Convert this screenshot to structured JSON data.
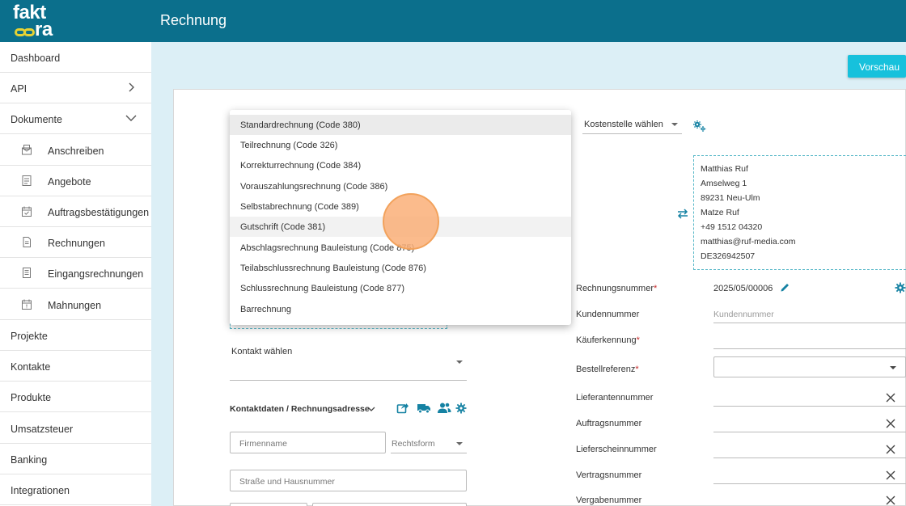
{
  "header": {
    "logo_line1": "fakt",
    "logo_line2": "ra",
    "title": "Rechnung"
  },
  "sidebar": {
    "items": [
      {
        "label": "Dashboard"
      },
      {
        "label": "API"
      },
      {
        "label": "Dokumente"
      },
      {
        "label": "Anschreiben"
      },
      {
        "label": "Angebote"
      },
      {
        "label": "Auftragsbestätigungen"
      },
      {
        "label": "Rechnungen"
      },
      {
        "label": "Eingangsrechnungen"
      },
      {
        "label": "Mahnungen"
      },
      {
        "label": "Projekte"
      },
      {
        "label": "Kontakte"
      },
      {
        "label": "Produkte"
      },
      {
        "label": "Umsatzsteuer"
      },
      {
        "label": "Banking"
      },
      {
        "label": "Integrationen"
      }
    ]
  },
  "toolbar": {
    "preview_label": "Vorschau"
  },
  "invoice_type_menu": {
    "options": [
      "Standardrechnung (Code 380)",
      "Teilrechnung (Code 326)",
      "Korrekturrechnung (Code 384)",
      "Vorauszahlungsrechnung (Code 386)",
      "Selbstabrechnung (Code 389)",
      "Gutschrift (Code 381)",
      "Abschlagsrechnung Bauleistung (Code 875)",
      "Teilabschlussrechnung Bauleistung (Code 876)",
      "Schlussrechnung Bauleistung (Code 877)",
      "Barrechnung"
    ],
    "selected": "Standardrechnung (Code 380)",
    "hovered": "Gutschrift (Code 381)"
  },
  "cost_center": {
    "label": "Kostenstelle wählen"
  },
  "sender_address": {
    "lines": [
      "Matthias Ruf",
      "Amselweg 1",
      "89231 Neu-Ulm",
      "Matze Ruf",
      "+49 1512 04320",
      "matthias@ruf-media.com",
      "DE326942507"
    ]
  },
  "contact": {
    "select_label": "Kontakt wählen",
    "section_title": "Kontaktdaten / Rechnungsadresse",
    "company_placeholder": "Firmenname",
    "legal_form_placeholder": "Rechtsform",
    "street_placeholder": "Straße und Hausnummer"
  },
  "invoice_fields": {
    "number_label": "Rechnungsnummer",
    "number_value": "2025/05/00006",
    "customer_number_label": "Kundennummer",
    "customer_number_placeholder": "Kundennummer",
    "buyer_id_label": "Käuferkennung",
    "order_ref_label": "Bestellreferenz",
    "supplier_number_label": "Lieferantennummer",
    "order_number_label": "Auftragsnummer",
    "delivery_note_label": "Lieferscheinnummer",
    "contract_number_label": "Vertragsnummer",
    "award_number_label": "Vergabenummer",
    "required_mark": "*"
  }
}
